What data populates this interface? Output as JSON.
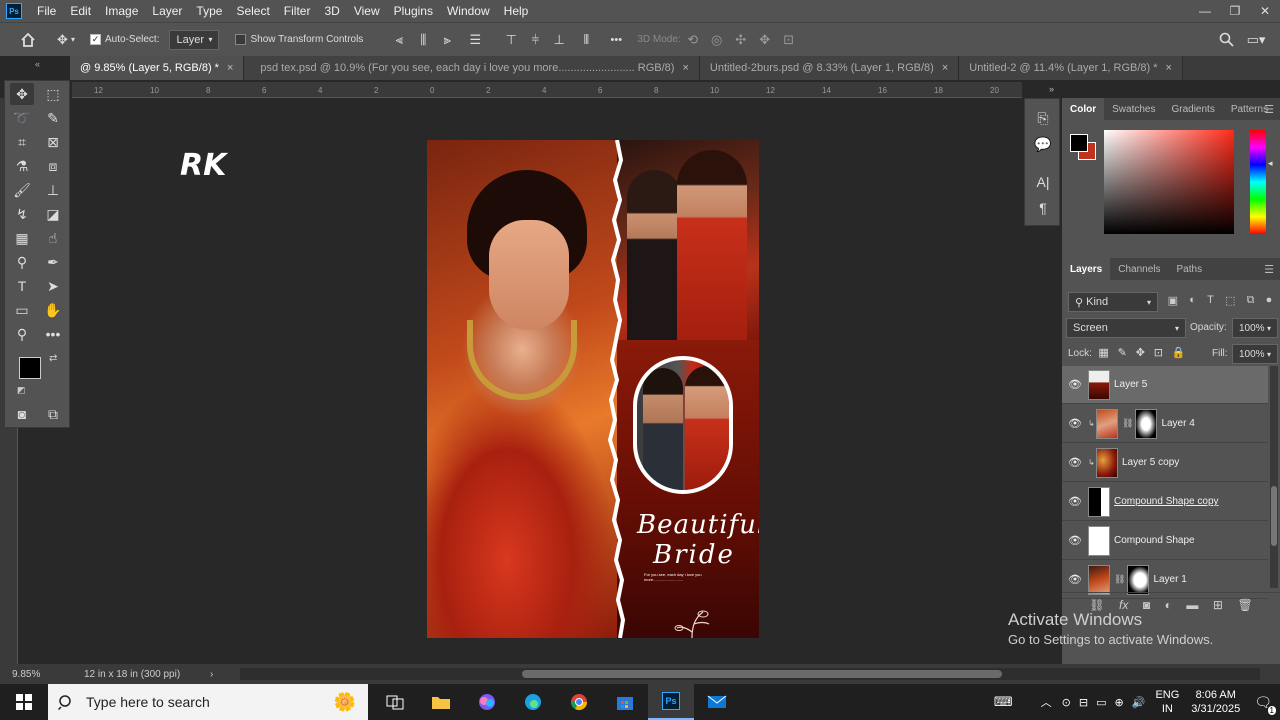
{
  "menubar": {
    "logo": "Ps",
    "items": [
      "File",
      "Edit",
      "Image",
      "Layer",
      "Type",
      "Select",
      "Filter",
      "3D",
      "View",
      "Plugins",
      "Window",
      "Help"
    ],
    "window_controls": [
      "—",
      "❐",
      "✕"
    ]
  },
  "options": {
    "auto_select_label": "Auto-Select:",
    "auto_select_value": "Layer",
    "show_transform_label": "Show Transform Controls",
    "mode_3d_label": "3D Mode:",
    "more": "•••"
  },
  "tabs": [
    {
      "label": "@ 9.85% (Layer 5, RGB/8) *",
      "active": true
    },
    {
      "label": "psd tex.psd @ 10.9% (For you see, each day i love you more......................... RGB/8)",
      "active": false
    },
    {
      "label": "Untitled-2burs.psd @ 8.33% (Layer 1, RGB/8)",
      "active": false
    },
    {
      "label": "Untitled-2 @ 11.4% (Layer 1, RGB/8) *",
      "active": false
    }
  ],
  "ruler": {
    "top_ticks": [
      "12",
      "10",
      "8",
      "6",
      "4",
      "2",
      "0",
      "2",
      "4",
      "6",
      "8",
      "10",
      "12",
      "14",
      "16",
      "18",
      "20"
    ]
  },
  "canvas": {
    "rk_text": "RK",
    "artwork": {
      "title_line1": "Beautiful",
      "title_line2": "Bride",
      "tagline": "For you see, each day i love you more..........................."
    }
  },
  "color_panel": {
    "tabs": [
      "Color",
      "Swatches",
      "Gradients",
      "Patterns"
    ],
    "foreground": "#000000",
    "background": "#c0321e"
  },
  "layers_panel": {
    "tabs": [
      "Layers",
      "Channels",
      "Paths"
    ],
    "filter_kind": "Kind",
    "blend_mode": "Screen",
    "opacity_label": "Opacity:",
    "opacity_value": "100%",
    "lock_label": "Lock:",
    "fill_label": "Fill:",
    "fill_value": "100%",
    "layers": [
      {
        "name": "Layer 5",
        "selected": true
      },
      {
        "name": "Layer 4",
        "selected": false
      },
      {
        "name": "Layer 5 copy",
        "selected": false
      },
      {
        "name": "Compound Shape copy",
        "selected": false
      },
      {
        "name": "Compound Shape",
        "selected": false
      },
      {
        "name": "Layer 1",
        "selected": false
      }
    ]
  },
  "status": {
    "zoom": "9.85%",
    "doc_size": "12 in x 18 in (300 ppi)",
    "arrow": "›"
  },
  "watermark": {
    "line1": "Activate Windows",
    "line2": "Go to Settings to activate Windows."
  },
  "taskbar": {
    "search_placeholder": "Type here to search",
    "lang_line1": "ENG",
    "lang_line2": "IN",
    "time": "8:06 AM",
    "date": "3/31/2025",
    "notification_count": "1"
  }
}
